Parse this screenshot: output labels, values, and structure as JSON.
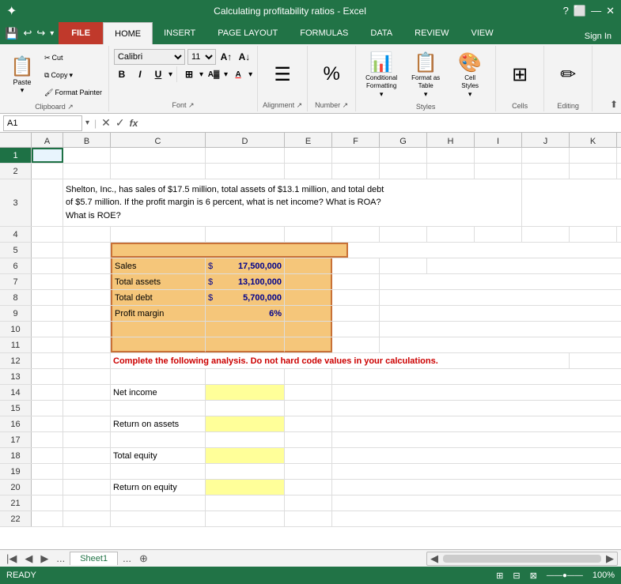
{
  "titleBar": {
    "title": "Calculating profitability ratios - Excel",
    "controls": [
      "?",
      "⬜",
      "—",
      "✕"
    ]
  },
  "quickAccess": {
    "icons": [
      "💾",
      "↩",
      "↪",
      "▾"
    ]
  },
  "ribbonTabs": [
    "FILE",
    "HOME",
    "INSERT",
    "PAGE LAYOUT",
    "FORMULAS",
    "DATA",
    "REVIEW",
    "VIEW"
  ],
  "activeTab": "HOME",
  "signIn": "Sign In",
  "ribbon": {
    "groups": [
      {
        "label": "Clipboard",
        "name": "clipboard"
      },
      {
        "label": "Font",
        "name": "font"
      },
      {
        "label": "Alignment",
        "name": "alignment"
      },
      {
        "label": "Number",
        "name": "number"
      },
      {
        "label": "Styles",
        "name": "styles"
      },
      {
        "label": "Cells",
        "name": "cells"
      },
      {
        "label": "Editing",
        "name": "editing"
      }
    ],
    "font": {
      "name": "Calibri",
      "size": "11"
    },
    "conditionalFormatting": "Conditional\nFormatting",
    "formatAsTable": "Format as\nTable",
    "cellStyles": "Cell\nStyles",
    "cells": "Cells",
    "editing": "Editing"
  },
  "formulaBar": {
    "nameBox": "A1",
    "formula": ""
  },
  "columns": [
    "A",
    "B",
    "C",
    "D",
    "E",
    "F",
    "G",
    "H",
    "I",
    "J",
    "K"
  ],
  "rows": [
    {
      "num": "1",
      "selected": true
    },
    {
      "num": "2"
    },
    {
      "num": "3",
      "tall": true
    },
    {
      "num": "4"
    },
    {
      "num": "5"
    },
    {
      "num": "6"
    },
    {
      "num": "7"
    },
    {
      "num": "8"
    },
    {
      "num": "9"
    },
    {
      "num": "10"
    },
    {
      "num": "11"
    },
    {
      "num": "12"
    },
    {
      "num": "13"
    },
    {
      "num": "14"
    },
    {
      "num": "15"
    },
    {
      "num": "16"
    },
    {
      "num": "17"
    },
    {
      "num": "18"
    },
    {
      "num": "19"
    },
    {
      "num": "20"
    },
    {
      "num": "21"
    },
    {
      "num": "22"
    }
  ],
  "problemText": "Shelton, Inc., has sales of $17.5 million, total assets of $13.1 million, and total debt\nof $5.7 million. If the profit margin is 6 percent, what is net income? What is ROA?\nWhat is ROE?",
  "orangeBox": {
    "rows": [
      {
        "label": "Sales",
        "dollar": "$",
        "value": "17,500,000"
      },
      {
        "label": "Total assets",
        "dollar": "$",
        "value": "13,100,000"
      },
      {
        "label": "Total debt",
        "dollar": "$",
        "value": "5,700,000"
      },
      {
        "label": "Profit margin",
        "dollar": "",
        "value": "6%"
      }
    ]
  },
  "instructionText": "Complete the following analysis. Do not hard code values in your calculations.",
  "analysisRows": [
    {
      "label": "Net income",
      "rowNum": "14"
    },
    {
      "label": "Return on assets",
      "rowNum": "16"
    },
    {
      "label": "Total equity",
      "rowNum": "18"
    },
    {
      "label": "Return on equity",
      "rowNum": "20"
    }
  ],
  "sheetTabs": [
    "Sheet1"
  ],
  "statusBar": {
    "ready": "READY",
    "zoom": "100%"
  }
}
